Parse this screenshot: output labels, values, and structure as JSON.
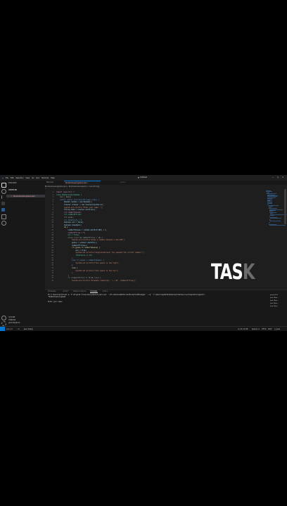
{
  "window": {
    "title": "▲ Untitled",
    "menu": [
      "File",
      "Edit",
      "Selection",
      "View",
      "Go",
      "Run",
      "Terminal",
      "Help"
    ]
  },
  "sidebar": {
    "header": "EXPLORER",
    "folder": "UNTITLED",
    "selected_file": "NumberGuessingGame.java",
    "outline": "OUTLINE",
    "timeline": "TIMELINE",
    "java_projects": "JAVA PROJECTS"
  },
  "tabs": [
    "Welcome",
    "NumberGuessingGame.java"
  ],
  "breadcrumb": "NumberGuessingGame.java > NumberGuessingGame > main(String[])",
  "code_lines": [
    "import java.util.*;",
    "class NumberGuessingGame {",
    "    Run | Debug",
    "    public static void main(String[] args) {",
    "        Random random = new Random();",
    "        Scanner scanner = new Scanner(System.in);",
    "        System.out.println(\"Enter your name: \");",
    "        String name = scanner.nextLine();",
    "        int numberToGuess;",
    "        int numberOfTries;",
    "        int guess;",
    "        int totalScore = 0;",
    "        boolean win = false;",
    "        boolean playAgain;",
    "        do {",
    "            numberToGuess = random.nextInt(100) + 1;",
    "            numberOfTries = 0;",
    "            win = false;",
    "            while (!win && numberOfTries < 10) {",
    "                System.out.println(\"Guess a number between 1 and 100\");",
    "                guess = scanner.nextInt();",
    "                numberOfTries++;",
    "                if (guess == numberToGuess) {",
    "                    win = true;",
    "                    System.out.println(\"Congratulations! You guessed the correct number!\");",
    "                    totalScore += 10;",
    "                }",
    "                else if (guess < numberToGuess) {",
    "                    System.out.println(\"Your guess is too high\");",
    "                }",
    "                else {",
    "                    System.out.println(\"Your guess is too low\");",
    "                }",
    "            }",
    "            if (numberOfTries == 10 && !win) {",
    "                System.out.println(\"Attempts remaining: \" + (10 - numberOfTries));"
  ],
  "panel": {
    "tabs": [
      "PROBLEMS",
      "OUTPUT",
      "DEBUG CONSOLE",
      "TERMINAL",
      "PORTS"
    ],
    "terminal_lines": [
      "PS C:\\Users\\Untitled> & 'C:\\Program Files\\Java\\jdk\\bin\\java.exe' '-XX:+ShowCodeDetailsInExceptionMessages' '-cp' 'C:\\Users\\AppData\\Roaming\\Code\\User\\workspaceStorage\\bin' 'NumberGuessingGame'",
      "Enter your name: "
    ],
    "terminal_list": [
      "powershell",
      "Java Debu...",
      "Java Debu...",
      "Java Debu...",
      "Java Debu..."
    ]
  },
  "status": {
    "left": [
      "⊗ 0 ⚠ 0",
      "⑂ 0",
      "Java: Ready"
    ],
    "right": [
      "Ln 23, Col 48",
      "Spaces: 4",
      "UTF-8",
      "CRLF",
      "{} Java"
    ]
  },
  "overlay": {
    "main": "TAS",
    "faded": "K"
  },
  "colors": {
    "accent": "#0078d4",
    "editor_bg": "#1e1e1e"
  }
}
